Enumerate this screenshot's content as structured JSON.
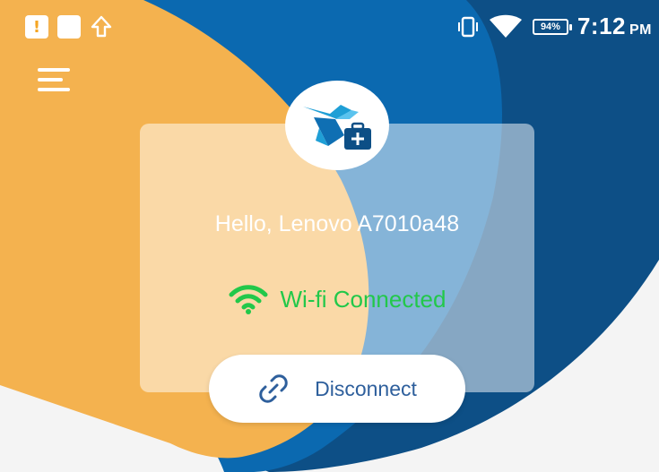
{
  "status_bar": {
    "notification_icons": [
      "alert-icon",
      "blank-notification-icon",
      "upload-arrow-icon"
    ],
    "right_icons": [
      "vibrate-icon",
      "wifi-signal-icon"
    ],
    "battery_level": "94%",
    "time": "7:12",
    "ampm": "PM"
  },
  "header": {
    "menu_icon": "hamburger-menu-icon",
    "logo_icon": "bird-with-medical-kit-logo-icon"
  },
  "card": {
    "greeting": "Hello, Lenovo A7010a48",
    "wifi_icon": "wifi-icon",
    "wifi_status": "Wi-fi Connected"
  },
  "disconnect_button": {
    "icon": "link-icon",
    "label": "Disconnect"
  },
  "colors": {
    "orange": "#f4b24f",
    "blue": "#0b69b0",
    "dark_blue": "#0d4f86",
    "wifi_green": "#22c84a",
    "button_text": "#2e5f9c",
    "background": "#f4f4f4"
  }
}
